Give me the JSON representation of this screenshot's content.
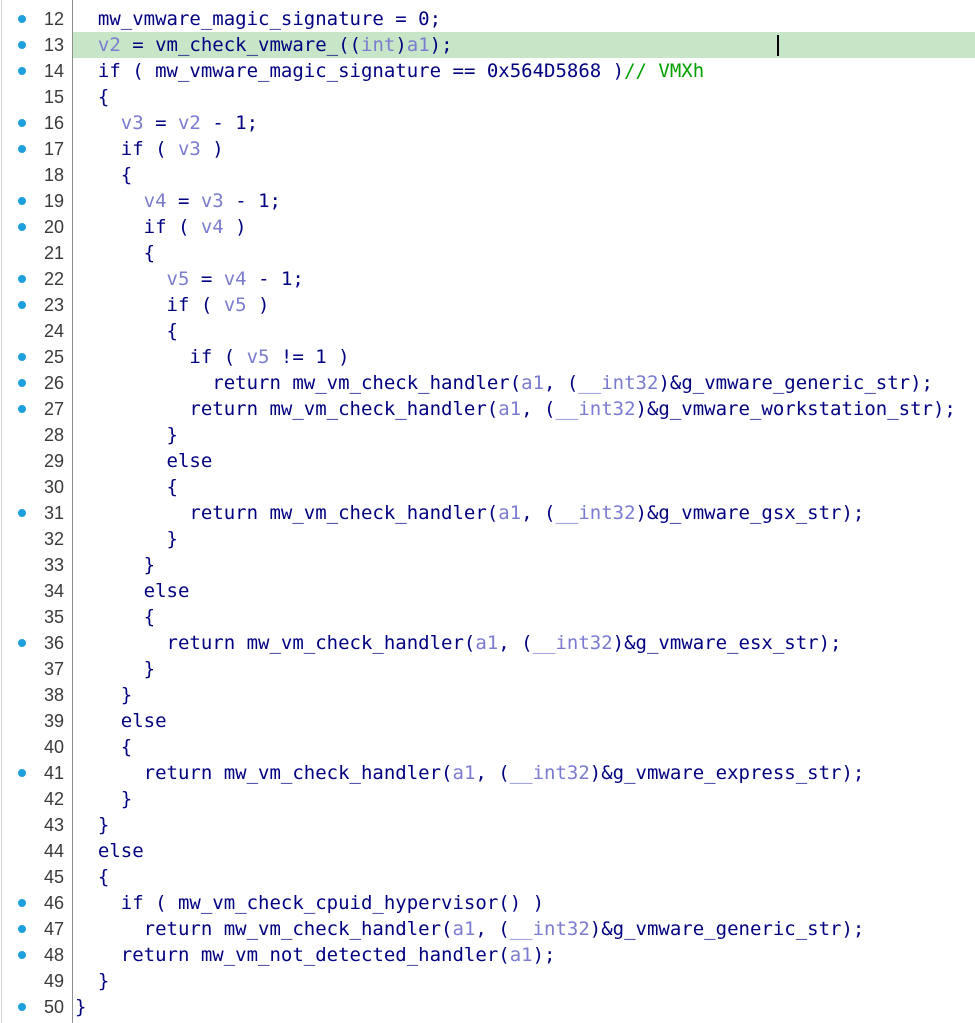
{
  "view": "pseudocode",
  "highlighted_line": 13,
  "lines": [
    {
      "num": "12",
      "bp": true,
      "indent": "  ",
      "segs": [
        {
          "t": "mw_vmware_magic_signature = 0;"
        }
      ]
    },
    {
      "num": "13",
      "bp": true,
      "indent": "  ",
      "segs": [
        {
          "t": "v2",
          "c": "vr"
        },
        {
          "t": " = vm_check_vmware_(("
        },
        {
          "t": "int",
          "c": "vr"
        },
        {
          "t": ")"
        },
        {
          "t": "a1",
          "c": "vr"
        },
        {
          "t": ");"
        }
      ]
    },
    {
      "num": "14",
      "bp": true,
      "indent": "  ",
      "segs": [
        {
          "t": "if ( mw_vmware_magic_signature == 0x564D5868 )"
        },
        {
          "t": "// VMXh",
          "c": "cm"
        }
      ]
    },
    {
      "num": "15",
      "bp": false,
      "indent": "  ",
      "segs": [
        {
          "t": "{"
        }
      ]
    },
    {
      "num": "16",
      "bp": true,
      "indent": "    ",
      "segs": [
        {
          "t": "v3",
          "c": "vr"
        },
        {
          "t": " = "
        },
        {
          "t": "v2",
          "c": "vr"
        },
        {
          "t": " - 1;"
        }
      ]
    },
    {
      "num": "17",
      "bp": true,
      "indent": "    ",
      "segs": [
        {
          "t": "if ( "
        },
        {
          "t": "v3",
          "c": "vr"
        },
        {
          "t": " )"
        }
      ]
    },
    {
      "num": "18",
      "bp": false,
      "indent": "    ",
      "segs": [
        {
          "t": "{"
        }
      ]
    },
    {
      "num": "19",
      "bp": true,
      "indent": "      ",
      "segs": [
        {
          "t": "v4",
          "c": "vr"
        },
        {
          "t": " = "
        },
        {
          "t": "v3",
          "c": "vr"
        },
        {
          "t": " - 1;"
        }
      ]
    },
    {
      "num": "20",
      "bp": true,
      "indent": "      ",
      "segs": [
        {
          "t": "if ( "
        },
        {
          "t": "v4",
          "c": "vr"
        },
        {
          "t": " )"
        }
      ]
    },
    {
      "num": "21",
      "bp": false,
      "indent": "      ",
      "segs": [
        {
          "t": "{"
        }
      ]
    },
    {
      "num": "22",
      "bp": true,
      "indent": "        ",
      "segs": [
        {
          "t": "v5",
          "c": "vr"
        },
        {
          "t": " = "
        },
        {
          "t": "v4",
          "c": "vr"
        },
        {
          "t": " - 1;"
        }
      ]
    },
    {
      "num": "23",
      "bp": true,
      "indent": "        ",
      "segs": [
        {
          "t": "if ( "
        },
        {
          "t": "v5",
          "c": "vr"
        },
        {
          "t": " )"
        }
      ]
    },
    {
      "num": "24",
      "bp": false,
      "indent": "        ",
      "segs": [
        {
          "t": "{"
        }
      ]
    },
    {
      "num": "25",
      "bp": true,
      "indent": "          ",
      "segs": [
        {
          "t": "if ( "
        },
        {
          "t": "v5",
          "c": "vr"
        },
        {
          "t": " != 1 )"
        }
      ]
    },
    {
      "num": "26",
      "bp": true,
      "indent": "            ",
      "segs": [
        {
          "t": "return mw_vm_check_handler("
        },
        {
          "t": "a1",
          "c": "vr"
        },
        {
          "t": ", ("
        },
        {
          "t": "__int32",
          "c": "vr"
        },
        {
          "t": ")&g_vmware_generic_str);"
        }
      ]
    },
    {
      "num": "27",
      "bp": true,
      "indent": "          ",
      "segs": [
        {
          "t": "return mw_vm_check_handler("
        },
        {
          "t": "a1",
          "c": "vr"
        },
        {
          "t": ", ("
        },
        {
          "t": "__int32",
          "c": "vr"
        },
        {
          "t": ")&g_vmware_workstation_str);"
        }
      ]
    },
    {
      "num": "28",
      "bp": false,
      "indent": "        ",
      "segs": [
        {
          "t": "}"
        }
      ]
    },
    {
      "num": "29",
      "bp": false,
      "indent": "        ",
      "segs": [
        {
          "t": "else"
        }
      ]
    },
    {
      "num": "30",
      "bp": false,
      "indent": "        ",
      "segs": [
        {
          "t": "{"
        }
      ]
    },
    {
      "num": "31",
      "bp": true,
      "indent": "          ",
      "segs": [
        {
          "t": "return mw_vm_check_handler("
        },
        {
          "t": "a1",
          "c": "vr"
        },
        {
          "t": ", ("
        },
        {
          "t": "__int32",
          "c": "vr"
        },
        {
          "t": ")&g_vmware_gsx_str);"
        }
      ]
    },
    {
      "num": "32",
      "bp": false,
      "indent": "        ",
      "segs": [
        {
          "t": "}"
        }
      ]
    },
    {
      "num": "33",
      "bp": false,
      "indent": "      ",
      "segs": [
        {
          "t": "}"
        }
      ]
    },
    {
      "num": "34",
      "bp": false,
      "indent": "      ",
      "segs": [
        {
          "t": "else"
        }
      ]
    },
    {
      "num": "35",
      "bp": false,
      "indent": "      ",
      "segs": [
        {
          "t": "{"
        }
      ]
    },
    {
      "num": "36",
      "bp": true,
      "indent": "        ",
      "segs": [
        {
          "t": "return mw_vm_check_handler("
        },
        {
          "t": "a1",
          "c": "vr"
        },
        {
          "t": ", ("
        },
        {
          "t": "__int32",
          "c": "vr"
        },
        {
          "t": ")&g_vmware_esx_str);"
        }
      ]
    },
    {
      "num": "37",
      "bp": false,
      "indent": "      ",
      "segs": [
        {
          "t": "}"
        }
      ]
    },
    {
      "num": "38",
      "bp": false,
      "indent": "    ",
      "segs": [
        {
          "t": "}"
        }
      ]
    },
    {
      "num": "39",
      "bp": false,
      "indent": "    ",
      "segs": [
        {
          "t": "else"
        }
      ]
    },
    {
      "num": "40",
      "bp": false,
      "indent": "    ",
      "segs": [
        {
          "t": "{"
        }
      ]
    },
    {
      "num": "41",
      "bp": true,
      "indent": "      ",
      "segs": [
        {
          "t": "return mw_vm_check_handler("
        },
        {
          "t": "a1",
          "c": "vr"
        },
        {
          "t": ", ("
        },
        {
          "t": "__int32",
          "c": "vr"
        },
        {
          "t": ")&g_vmware_express_str);"
        }
      ]
    },
    {
      "num": "42",
      "bp": false,
      "indent": "    ",
      "segs": [
        {
          "t": "}"
        }
      ]
    },
    {
      "num": "43",
      "bp": false,
      "indent": "  ",
      "segs": [
        {
          "t": "}"
        }
      ]
    },
    {
      "num": "44",
      "bp": false,
      "indent": "  ",
      "segs": [
        {
          "t": "else"
        }
      ]
    },
    {
      "num": "45",
      "bp": false,
      "indent": "  ",
      "segs": [
        {
          "t": "{"
        }
      ]
    },
    {
      "num": "46",
      "bp": true,
      "indent": "    ",
      "segs": [
        {
          "t": "if ( mw_vm_check_cpuid_hypervisor() )"
        }
      ]
    },
    {
      "num": "47",
      "bp": true,
      "indent": "      ",
      "segs": [
        {
          "t": "return mw_vm_check_handler("
        },
        {
          "t": "a1",
          "c": "vr"
        },
        {
          "t": ", ("
        },
        {
          "t": "__int32",
          "c": "vr"
        },
        {
          "t": ")&g_vmware_generic_str);"
        }
      ]
    },
    {
      "num": "48",
      "bp": true,
      "indent": "    ",
      "segs": [
        {
          "t": "return mw_vm_not_detected_handler("
        },
        {
          "t": "a1",
          "c": "vr"
        },
        {
          "t": ");"
        }
      ]
    },
    {
      "num": "49",
      "bp": false,
      "indent": "  ",
      "segs": [
        {
          "t": "}"
        }
      ]
    },
    {
      "num": "50",
      "bp": true,
      "indent": "",
      "segs": [
        {
          "t": "}"
        }
      ]
    }
  ]
}
